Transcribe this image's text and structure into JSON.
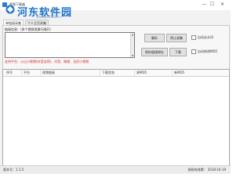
{
  "window": {
    "title": "视频下载器",
    "controls": {
      "minimize": "—",
      "maximize": "☐",
      "close": "✕"
    }
  },
  "watermark": {
    "text": "河东软件园",
    "url": "www.pc0359.cn"
  },
  "tabs": [
    {
      "label": "单链接采集"
    },
    {
      "label": "个人主页采集"
    }
  ],
  "input": {
    "label": "链接信息:（多个视频用换行隔开）",
    "value": ""
  },
  "buttons": {
    "parse": "解析",
    "stop": "停止采集",
    "save_links": "保存链接地址",
    "download": "下载"
  },
  "options": {
    "auto_remove_watermark": "自动去水印",
    "auto_md5": "自动修改MD5"
  },
  "support_text": "支持平台：火山小视频(抖音全网)、抖音、微视、全民小视频",
  "table": {
    "columns": [
      "序号",
      "平台",
      "视频链接",
      "下载状态",
      "原MD5",
      "新MD5"
    ],
    "rows": []
  },
  "status": {
    "version": "版本号：1.1.5",
    "expiry": "授权有效期：  2018-10-19"
  }
}
